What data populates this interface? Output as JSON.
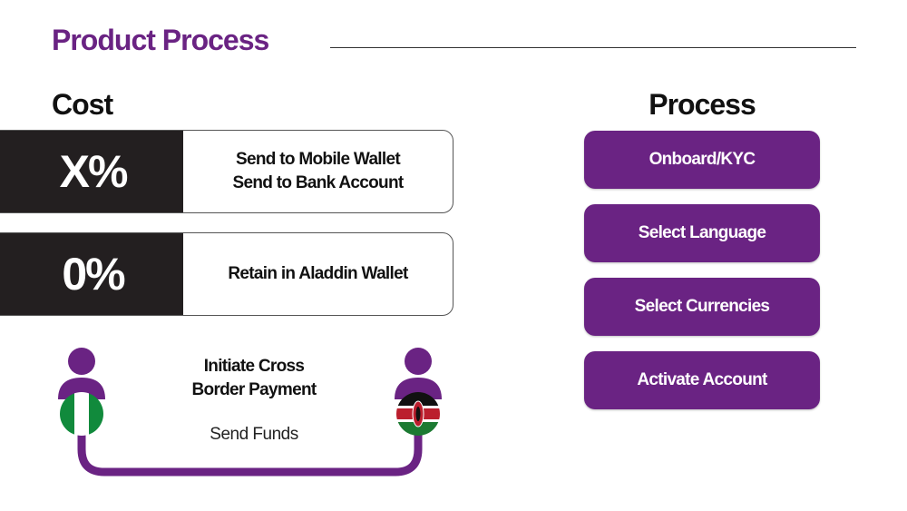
{
  "page": {
    "title": "Product Process"
  },
  "cost": {
    "heading": "Cost",
    "rows": [
      {
        "percent": "X%",
        "lines": [
          "Send to Mobile Wallet",
          "Send to Bank Account"
        ]
      },
      {
        "percent": "0%",
        "lines": [
          "Retain in Aladdin Wallet"
        ]
      }
    ]
  },
  "process": {
    "heading": "Process",
    "steps": [
      "Onboard/KYC",
      "Select Language",
      "Select Currencies",
      "Activate Account"
    ]
  },
  "transfer": {
    "title_lines": [
      "Initiate Cross",
      "Border Payment"
    ],
    "action": "Send Funds",
    "sender_flag": "nigeria-flag",
    "receiver_flag": "kenya-flag"
  },
  "colors": {
    "brand_purple": "#6a2383",
    "dark": "#231f20"
  }
}
